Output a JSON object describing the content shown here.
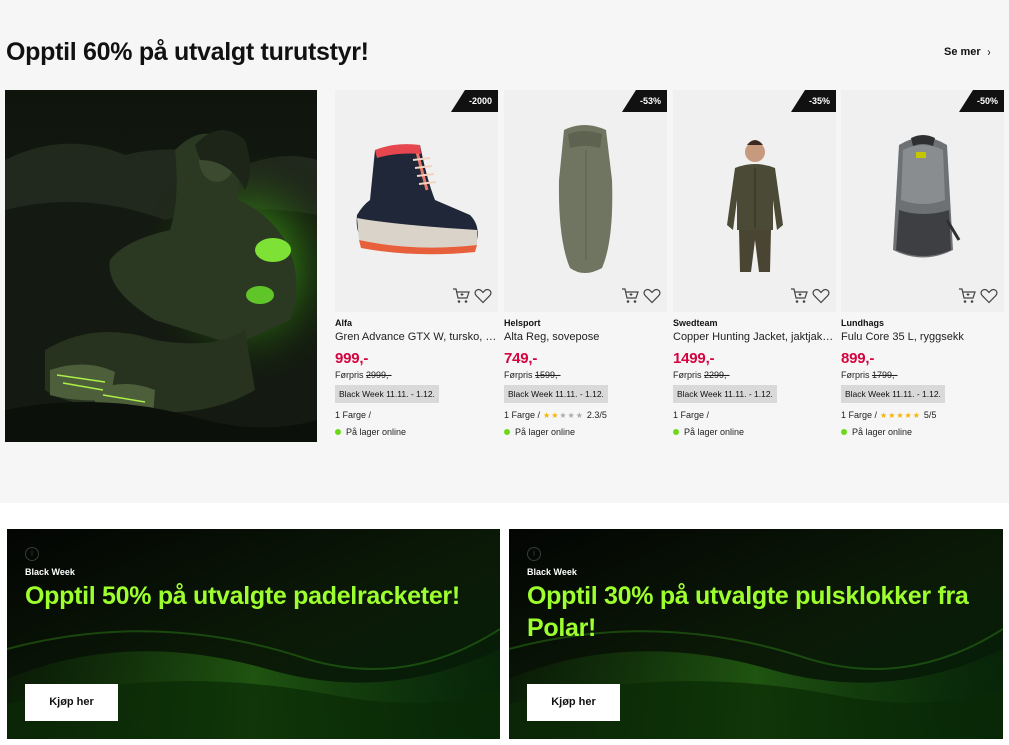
{
  "section": {
    "title": "Opptil 60% på utvalgt turutstyr!",
    "see_more": "Se mer"
  },
  "products": [
    {
      "badge": "-2000",
      "brand": "Alfa",
      "name": "Gren Advance GTX W, tursko, dame",
      "price": "999,-",
      "before_label": "Førpris",
      "before_price": "2999,-",
      "campaign": "Black Week 11.11. - 1.12.",
      "colors": "1 Farge /",
      "rating": "",
      "stock": "På lager online"
    },
    {
      "badge": "-53%",
      "brand": "Helsport",
      "name": "Alta Reg, sovepose",
      "price": "749,-",
      "before_label": "Førpris",
      "before_price": "1599,-",
      "campaign": "Black Week 11.11. - 1.12.",
      "colors": "1 Farge /",
      "rating": "2.3/5",
      "rating_value": 2.3,
      "stock": "På lager online"
    },
    {
      "badge": "-35%",
      "brand": "Swedteam",
      "name": "Copper Hunting Jacket, jaktjakke, herre",
      "price": "1499,-",
      "before_label": "Førpris",
      "before_price": "2299,-",
      "campaign": "Black Week 11.11. - 1.12.",
      "colors": "1 Farge /",
      "rating": "",
      "stock": "På lager online"
    },
    {
      "badge": "-50%",
      "brand": "Lundhags",
      "name": "Fulu Core 35 L, ryggsekk",
      "price": "899,-",
      "before_label": "Førpris",
      "before_price": "1799,-",
      "campaign": "Black Week 11.11. - 1.12.",
      "colors": "1 Farge /",
      "rating": "5/5",
      "rating_value": 5,
      "stock": "På lager online"
    }
  ],
  "promos": [
    {
      "kicker": "Black Week",
      "headline": "Opptil 50% på utvalgte padelracketer!",
      "button": "Kjøp her"
    },
    {
      "kicker": "Black Week",
      "headline": "Opptil 30% på utvalgte pulsklokker fra Polar!",
      "button": "Kjøp her"
    }
  ],
  "colors": {
    "price": "#d4043f",
    "accent_green": "#9dff2e",
    "stock_dot": "#6bd81a",
    "star": "#f5b400"
  },
  "icons": [
    "cart-icon",
    "heart-icon",
    "chevron-right-icon",
    "info-icon",
    "star-icon"
  ]
}
